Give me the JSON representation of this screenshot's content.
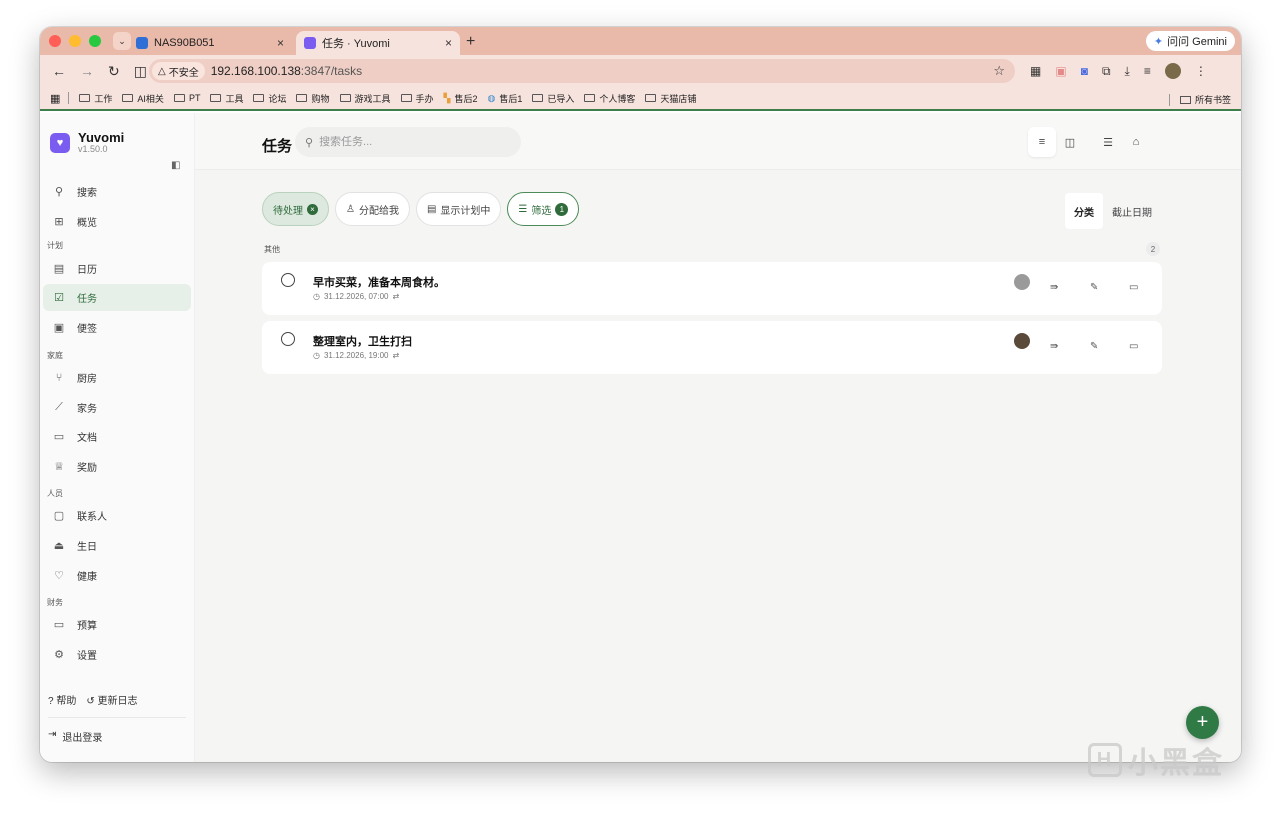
{
  "browser": {
    "tabs": [
      {
        "label": "NAS90B051",
        "close": "×"
      },
      {
        "label": "任务 · Yuvomi",
        "close": "×"
      }
    ],
    "new_tab": "+",
    "gemini_label": "问问 Gemini",
    "insecure_label": "不安全",
    "url_host": "192.168.100.138",
    "url_path": ":3847/tasks",
    "bookmarks": [
      "工作",
      "AI相关",
      "PT",
      "工具",
      "论坛",
      "购物",
      "游戏工具",
      "手办",
      "售后2",
      "售后1",
      "已导入",
      "个人博客",
      "天猫店铺"
    ],
    "all_bookmarks": "所有书签"
  },
  "brand": {
    "name": "Yuvomi",
    "version": "v1.50.0"
  },
  "sidebar": {
    "search": "搜索",
    "overview": "概览",
    "group_plan": "计划",
    "calendar": "日历",
    "tasks": "任务",
    "notes": "便签",
    "group_home": "家庭",
    "kitchen": "厨房",
    "chores": "家务",
    "documents": "文档",
    "rewards": "奖励",
    "group_people": "人员",
    "contacts": "联系人",
    "birthdays": "生日",
    "health": "健康",
    "group_finance": "财务",
    "budget": "预算",
    "settings": "设置",
    "help": "帮助",
    "changelog": "更新日志",
    "logout": "退出登录"
  },
  "header": {
    "title": "任务",
    "search_placeholder": "搜索任务..."
  },
  "filters": {
    "pending": "待处理",
    "assigned_to_me": "分配给我",
    "show_in_plan": "显示计划中",
    "filter": "筛选",
    "filter_count": "1"
  },
  "sort": {
    "category": "分类",
    "due_date": "截止日期"
  },
  "section": {
    "label": "其他",
    "count": "2"
  },
  "tasks": [
    {
      "title": "早市买菜，准备本周食材。",
      "due": "31.12.2026, 07:00"
    },
    {
      "title": "整理室内，卫生打扫",
      "due": "31.12.2026, 19:00"
    }
  ],
  "watermark": "小黑盒",
  "colors": {
    "accent": "#2f6b3b",
    "brand": "#7b5cf0",
    "titlebar": "#e9b9a9"
  }
}
